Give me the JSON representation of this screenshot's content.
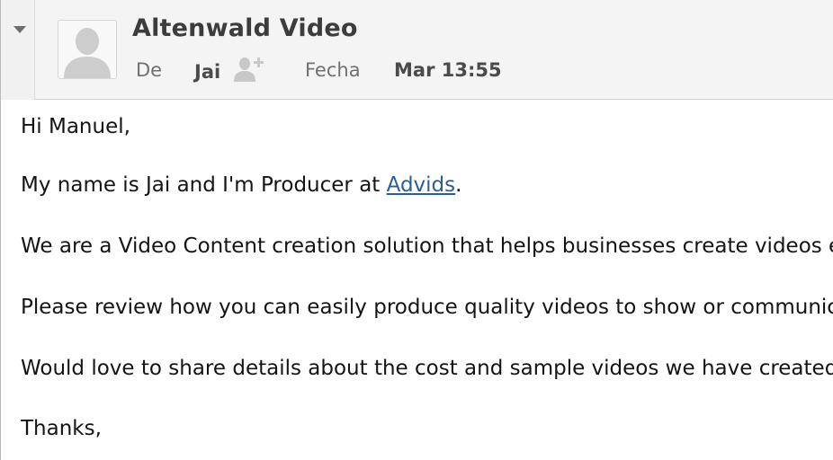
{
  "header": {
    "sender_name": "Altenwald Video",
    "from_label": "De",
    "from_value": "Jai",
    "date_label": "Fecha",
    "date_value": "Mar 13:55"
  },
  "icons": {
    "collapse": "chevron-down-icon",
    "avatar": "person-silhouette-icon",
    "add_contact": "add-contact-icon"
  },
  "message": {
    "greeting": "Hi Manuel,",
    "intro_before_link": "My name is Jai and I'm Producer at ",
    "intro_link": "Advids",
    "intro_after_link": ".",
    "line3": "We are a Video Content creation solution that helps businesses create videos e",
    "line4": "Please review how you can easily produce quality videos to show or communica",
    "line5": "Would love to share details about the cost and sample videos we have created",
    "closing": "Thanks,"
  },
  "colors": {
    "link": "#2a5f93",
    "header_bg": "#f4f4f4"
  }
}
